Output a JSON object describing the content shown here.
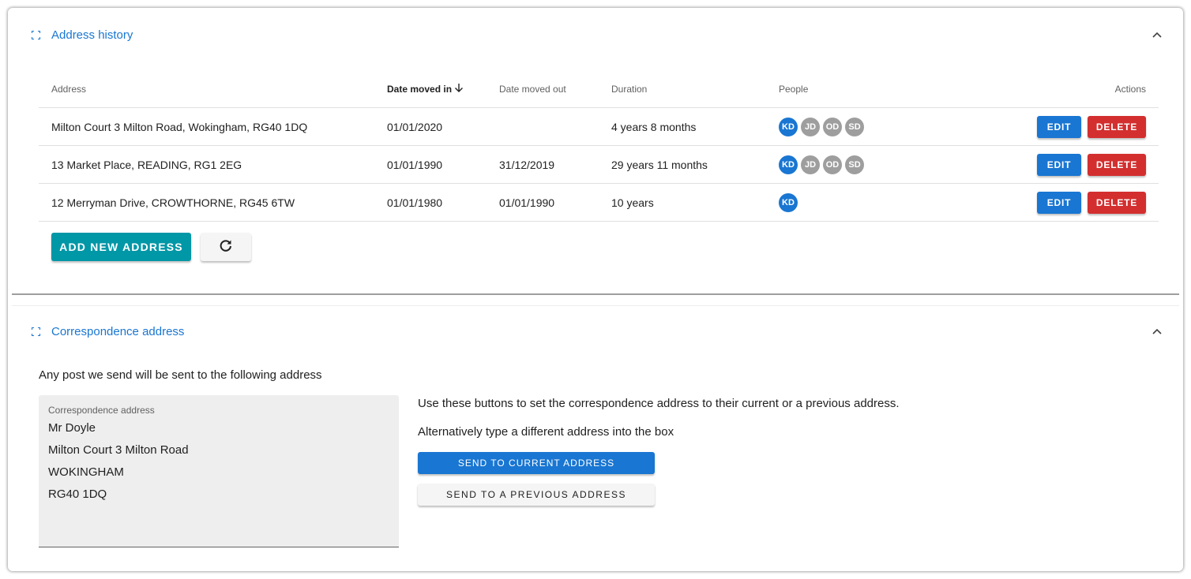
{
  "address_history": {
    "title": "Address history",
    "columns": {
      "address": "Address",
      "date_moved_in": "Date moved in",
      "date_moved_out": "Date moved out",
      "duration": "Duration",
      "people": "People",
      "actions": "Actions"
    },
    "rows": [
      {
        "address": "Milton Court 3 Milton Road, Wokingham, RG40 1DQ",
        "date_moved_in": "01/01/2020",
        "date_moved_out": "",
        "duration": "4 years 8 months",
        "people": [
          "KD",
          "JD",
          "OD",
          "SD"
        ]
      },
      {
        "address": "13 Market Place, READING, RG1 2EG",
        "date_moved_in": "01/01/1990",
        "date_moved_out": "31/12/2019",
        "duration": "29 years 11 months",
        "people": [
          "KD",
          "JD",
          "OD",
          "SD"
        ]
      },
      {
        "address": "12 Merryman Drive, CROWTHORNE, RG45 6TW",
        "date_moved_in": "01/01/1980",
        "date_moved_out": "01/01/1990",
        "duration": "10 years",
        "people": [
          "KD"
        ]
      }
    ],
    "edit_label": "EDIT",
    "delete_label": "DELETE",
    "add_label": "ADD NEW ADDRESS"
  },
  "correspondence": {
    "title": "Correspondence address",
    "intro": "Any post we send will be sent to the following address",
    "field_label": "Correspondence address",
    "lines": [
      "Mr Doyle",
      "Milton Court 3 Milton Road",
      "WOKINGHAM",
      "RG40 1DQ"
    ],
    "help_1": "Use these buttons to set the correspondence address to their current or a previous address.",
    "help_2": "Alternatively type a different address into the box",
    "send_current_label": "SEND TO CURRENT ADDRESS",
    "send_previous_label": "SEND TO A PREVIOUS ADDRESS"
  },
  "colors": {
    "primary": "#1976d2",
    "danger": "#d32f2f",
    "accent": "#0097a7",
    "avatar_inactive": "#9e9e9e"
  }
}
